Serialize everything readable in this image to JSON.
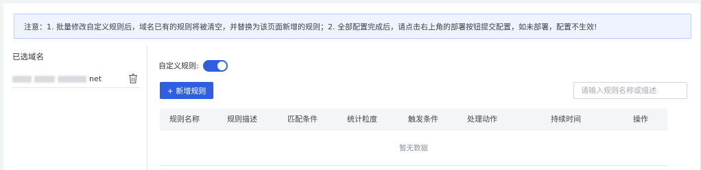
{
  "notice": {
    "text": "注意：1. 批量修改自定义规则后，域名已有的规则将被清空，并替换为该页面新增的规则；2. 全部配置完成后，请点击右上角的部署按钮提交配置，如未部署，配置不生效!"
  },
  "left_panel": {
    "title": "已选域名",
    "domains": [
      {
        "name_suffix": "net",
        "delete_icon": "trash-icon"
      }
    ]
  },
  "rule_toggle": {
    "label": "自定义规则:",
    "enabled": true
  },
  "toolbar": {
    "add_label": "+ 新增规则",
    "search_placeholder": "请输入规则名称或描述"
  },
  "table": {
    "columns": [
      "规则名称",
      "规则描述",
      "匹配条件",
      "统计粒度",
      "触发条件",
      "处理动作",
      "持续时间",
      "操作"
    ],
    "empty_text": "暂无数据"
  },
  "colors": {
    "accent": "#2f5fe0",
    "notice_bg": "#eef3ff",
    "notice_border": "#bcd0f7"
  }
}
